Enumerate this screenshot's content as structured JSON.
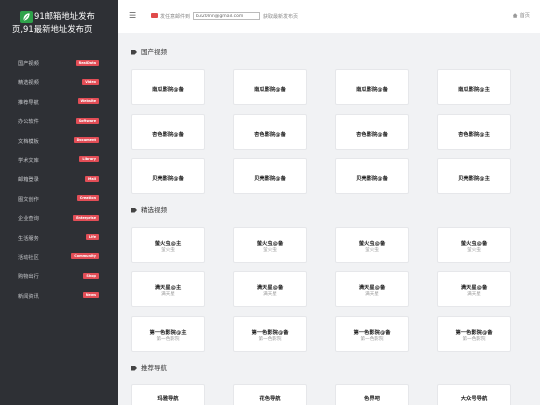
{
  "brand": {
    "title_line1": "91邮箱地址发布",
    "title_line2": "页,91最新地址发布页"
  },
  "sidebar": {
    "items": [
      {
        "label": "国产视频",
        "badge": "RealData"
      },
      {
        "label": "精选视频",
        "badge": "Video"
      },
      {
        "label": "推荐导航",
        "badge": "Website"
      },
      {
        "label": "办公软件",
        "badge": "Software"
      },
      {
        "label": "文档模板",
        "badge": "Document"
      },
      {
        "label": "学术文库",
        "badge": "Library"
      },
      {
        "label": "邮箱登录",
        "badge": "Mail"
      },
      {
        "label": "图文创作",
        "badge": "Creation"
      },
      {
        "label": "企业查询",
        "badge": "Enterprise"
      },
      {
        "label": "生活服务",
        "badge": "Life"
      },
      {
        "label": "活动社区",
        "badge": "Community"
      },
      {
        "label": "购物出行",
        "badge": "Shop"
      },
      {
        "label": "新闻资讯",
        "badge": "News"
      }
    ]
  },
  "topbar": {
    "menu_icon": "hamburger-icon",
    "mail_prefix": "发任意邮件到",
    "mail_value": "b320lnn@gmail.com",
    "mail_suffix": "获取最新发布页",
    "home_label": "首页"
  },
  "sections": [
    {
      "title": "国产视频",
      "cards": [
        {
          "title": "南瓜影院@备"
        },
        {
          "title": "南瓜影院@备"
        },
        {
          "title": "南瓜影院@备"
        },
        {
          "title": "南瓜影院@主"
        },
        {
          "title": "杏色影院@备"
        },
        {
          "title": "杏色影院@备"
        },
        {
          "title": "杏色影院@备"
        },
        {
          "title": "杏色影院@主"
        },
        {
          "title": "贝壳影院@备"
        },
        {
          "title": "贝壳影院@备"
        },
        {
          "title": "贝壳影院@备"
        },
        {
          "title": "贝壳影院@主"
        }
      ]
    },
    {
      "title": "精选视频",
      "cards": [
        {
          "title": "萤火虫@主",
          "sub": "萤火虫"
        },
        {
          "title": "萤火虫@备",
          "sub": "萤火虫"
        },
        {
          "title": "萤火虫@备",
          "sub": "萤火虫"
        },
        {
          "title": "萤火虫@备",
          "sub": "萤火虫"
        },
        {
          "title": "满天星@主",
          "sub": "满天星"
        },
        {
          "title": "满天星@备",
          "sub": "满天星"
        },
        {
          "title": "满天星@备",
          "sub": "满天星"
        },
        {
          "title": "满天星@备",
          "sub": "满天星"
        },
        {
          "title": "第一色影院@主",
          "sub": "第一色影院"
        },
        {
          "title": "第一色影院@备",
          "sub": "第一色影院"
        },
        {
          "title": "第一色影院@备",
          "sub": "第一色影院"
        },
        {
          "title": "第一色影院@备",
          "sub": "第一色影院"
        }
      ]
    },
    {
      "title": "推荐导航",
      "cards": [
        {
          "title": "玛雅导航"
        },
        {
          "title": "花色导航"
        },
        {
          "title": "色界吧"
        },
        {
          "title": "大众号导航"
        }
      ]
    }
  ]
}
